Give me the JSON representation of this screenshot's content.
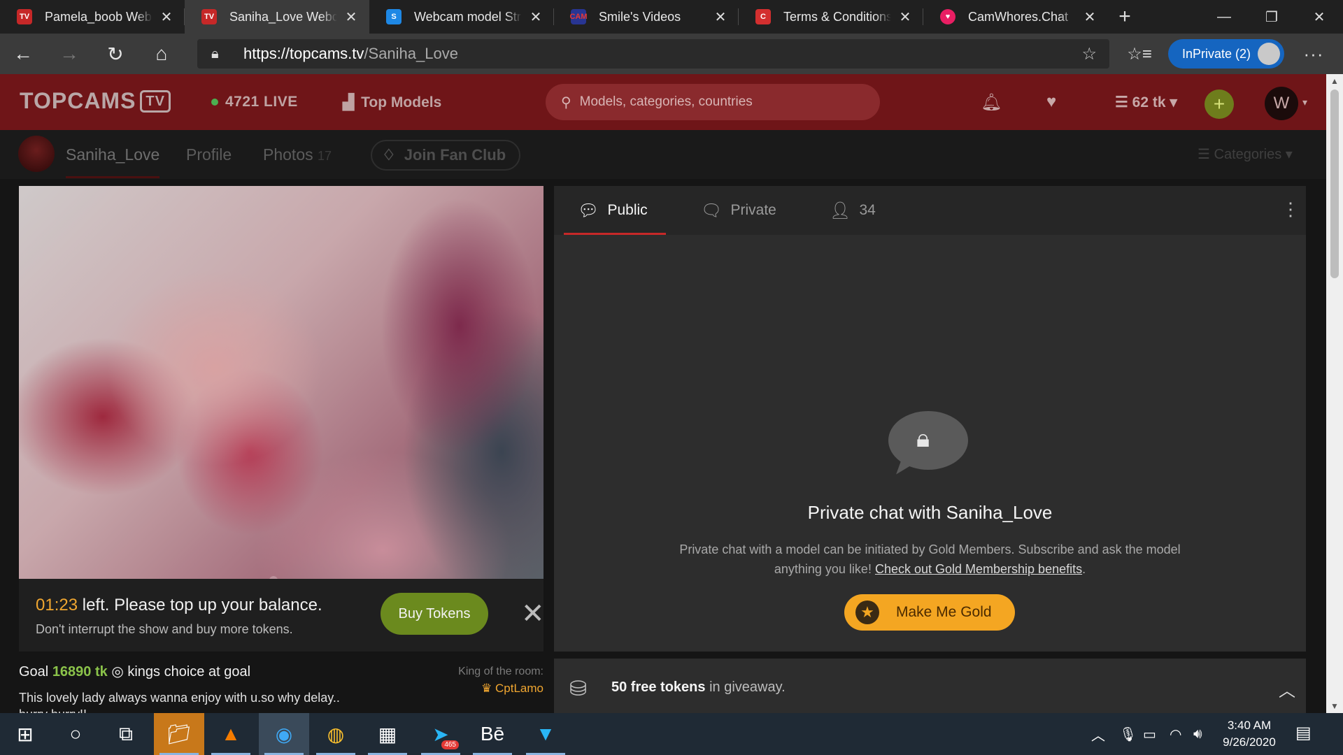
{
  "browser": {
    "tabs": [
      {
        "title": "Pamela_boob Webca",
        "favicon": "topcams-icon",
        "color": "#c62828",
        "active": false
      },
      {
        "title": "Saniha_Love Webcam",
        "favicon": "topcams-icon",
        "color": "#c62828",
        "active": true
      },
      {
        "title": "Webcam model Strip",
        "favicon": "camsoda-icon",
        "color": "#1e88e5",
        "active": false
      },
      {
        "title": "Smile's Videos",
        "favicon": "camhd-icon",
        "color": "#e53935",
        "active": false
      },
      {
        "title": "Terms & Conditions",
        "favicon": "chaturbate-icon",
        "color": "#d32f2f",
        "active": false
      },
      {
        "title": "CamWhores.Chat",
        "favicon": "camwhores-icon",
        "color": "#e91e63",
        "active": false
      }
    ],
    "url_host": "https://topcams.tv",
    "url_path": "/Saniha_Love",
    "inprivate_label": "InPrivate (2)"
  },
  "site": {
    "logo_text": "TOPCAMS",
    "logo_tv": "TV",
    "live_count": "4721 LIVE",
    "top_models": "Top Models",
    "search_placeholder": "Models, categories, countries",
    "tokens": "62 tk",
    "user_initial": "W"
  },
  "subnav": {
    "model_name": "Saniha_Love",
    "profile": "Profile",
    "photos": "Photos",
    "photos_count": "17",
    "fan_club": "Join Fan Club",
    "categories": "Categories"
  },
  "topup": {
    "time": "01:23",
    "message": " left. Please top up your balance.",
    "sub": "Don't interrupt the show and buy more tokens.",
    "buy_label": "Buy Tokens"
  },
  "goal": {
    "prefix": "Goal ",
    "amount": "16890 tk",
    "text": " kings choice at goal",
    "description": "This lovely lady always wanna enjoy with u.so why delay.. hurry hurry!!",
    "king_label": "King of the room:",
    "king_name": "CptLamo"
  },
  "chat": {
    "tab_public": "Public",
    "tab_private": "Private",
    "viewers": "34",
    "private_title": "Private chat with Saniha_Love",
    "private_desc": "Private chat with a model can be initiated by Gold Members. Subscribe and ask the model anything you like! ",
    "private_link": "Check out Gold Membership benefits",
    "private_end": ".",
    "gold_button": "Make Me Gold"
  },
  "giveaway": {
    "bold": "50 free tokens",
    "rest": " in giveaway."
  },
  "taskbar": {
    "time": "3:40 AM",
    "date": "9/26/2020",
    "telegram_badge": "465"
  }
}
